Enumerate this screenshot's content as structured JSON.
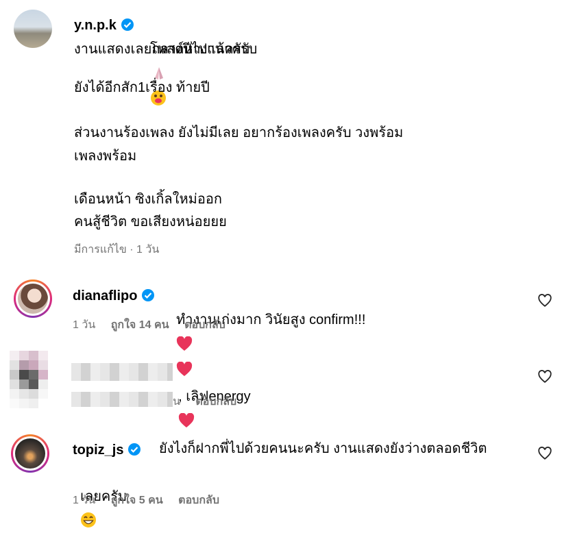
{
  "post": {
    "username": "y.n.p.k",
    "lines": [
      "โพสต์หางานครับ",
      "งานแสดงเลยกลางปีไปแล้วครับ",
      "",
      "ยังได้อีกสัก1เรื่อง ท้ายปี",
      "",
      "ส่วนงานร้องเพลง ยังไม่มีเลย อยากร้องเพลงครับ วงพร้อม",
      "เพลงพร้อม",
      "",
      "เดือนหน้า ซิงเกิ้ลใหม่ออก",
      "คนสู้ชีวิต ขอเสียงหน่อยยย"
    ],
    "meta": "มีการแก้ไข · 1 วัน"
  },
  "comments": [
    {
      "username": "dianaflipo",
      "text": "ทำงานเก่งมาก วินัยสูง confirm!!!",
      "time": "1 วัน",
      "likes": "ถูกใจ 14 คน",
      "reply": "ตอบกลับ"
    },
    {
      "username": "",
      "text": ", เลิฟenergy",
      "time_fragment": "น",
      "reply": "ตอบกลับ"
    },
    {
      "username": "topiz_js",
      "text_line1": "ยังไงก็ฝากพี่ไปด้วยคนนะครับ งานแสดงยังว่างตลอดชีวิต",
      "text_line2": "เลยครับ",
      "time": "1 วัน",
      "likes": "ถูกใจ 5 คน",
      "reply": "ตอบกลับ"
    }
  ],
  "icons": {
    "verified": "verified-badge-icon",
    "heart": "heart-outline-icon",
    "emoji_pray": "folded-hands-emoji",
    "emoji_face": "face-emoji",
    "emoji_heart": "red-heart-emoji",
    "emoji_grin": "grinning-face-emoji"
  },
  "colors": {
    "verified": "#0095f6",
    "meta": "#737373",
    "heart_emoji": "#e8345a"
  }
}
